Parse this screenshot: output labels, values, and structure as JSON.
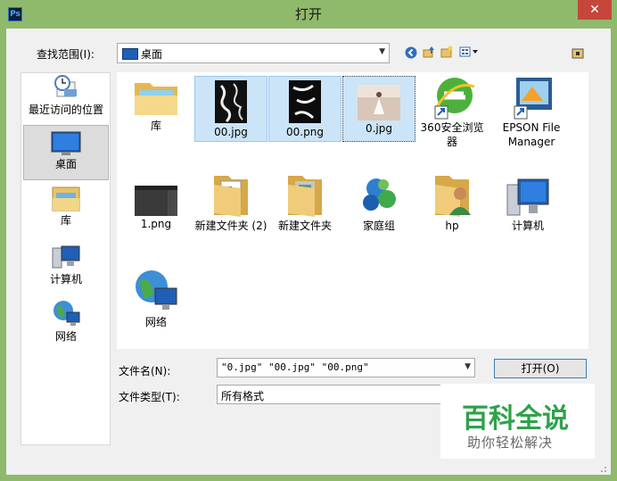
{
  "window": {
    "app_icon": "Ps",
    "title": "打开",
    "close_label": "✕"
  },
  "lookin": {
    "label": "查找范围(I):",
    "value": "桌面"
  },
  "toolbar": {
    "icons": [
      "back-icon",
      "up-folder-icon",
      "new-folder-icon",
      "view-menu-icon",
      "extra-folder-icon"
    ]
  },
  "places": [
    {
      "label": "最近访问的位置",
      "icon": "recent-places-icon"
    },
    {
      "label": "桌面",
      "icon": "desktop-icon",
      "selected": true
    },
    {
      "label": "库",
      "icon": "library-icon"
    },
    {
      "label": "计算机",
      "icon": "computer-icon"
    },
    {
      "label": "网络",
      "icon": "network-icon"
    }
  ],
  "files": [
    {
      "name": "库",
      "icon": "library-folder-icon"
    },
    {
      "name": "00.jpg",
      "icon": "image-thumbnail",
      "selected": true
    },
    {
      "name": "00.png",
      "icon": "image-thumbnail",
      "selected": true
    },
    {
      "name": "0.jpg",
      "icon": "photo-thumbnail",
      "selected": true
    },
    {
      "name": "360安全浏览器",
      "icon": "browser-shortcut-icon"
    },
    {
      "name": "EPSON File Manager",
      "icon": "epson-shortcut-icon"
    },
    {
      "name": "1.png",
      "icon": "screenshot-thumbnail"
    },
    {
      "name": "新建文件夹 (2)",
      "icon": "folder-icon"
    },
    {
      "name": "新建文件夹",
      "icon": "folder-icon"
    },
    {
      "name": "家庭组",
      "icon": "homegroup-icon"
    },
    {
      "name": "hp",
      "icon": "user-folder-icon"
    },
    {
      "name": "计算机",
      "icon": "computer-icon"
    },
    {
      "name": "网络",
      "icon": "network-icon"
    }
  ],
  "filename": {
    "label": "文件名(N):",
    "value": "\"0.jpg\" \"00.jpg\" \"00.png\""
  },
  "filetype": {
    "label": "文件类型(T):",
    "value": "所有格式"
  },
  "buttons": {
    "open": "打开(O)"
  },
  "watermark": {
    "line1": "百科全说",
    "line2": "助你轻松解决"
  },
  "colors": {
    "frame": "#8fb96b",
    "selection": "#cce4f7",
    "close": "#c7463b"
  }
}
